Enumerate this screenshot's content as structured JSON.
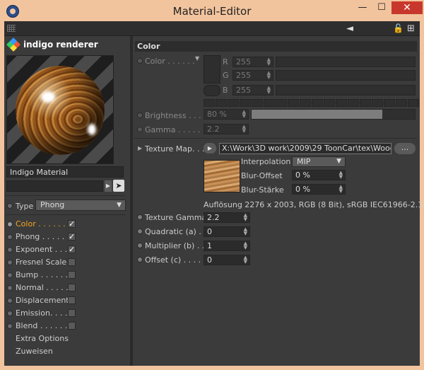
{
  "window": {
    "title": "Material-Editor",
    "min_label": "—",
    "max_label": "☐",
    "close_label": "✕"
  },
  "toolbar": {
    "arrow_glyph": "◄",
    "lock_glyph": "🔓",
    "new_glyph": "⊞"
  },
  "renderer": {
    "name": "indigo renderer"
  },
  "material": {
    "name": "Indigo Material",
    "input_value": ""
  },
  "type": {
    "label": "Type",
    "value": "Phong"
  },
  "channels": [
    {
      "label": "Color . . . . . .",
      "checked": "✓",
      "active": true
    },
    {
      "label": "Phong . . . . . .",
      "checked": "✓",
      "active": false
    },
    {
      "label": "Exponent . . .",
      "checked": "✓",
      "active": false
    },
    {
      "label": "Fresnel Scale",
      "checked": "",
      "active": false
    },
    {
      "label": "Bump . . . . . .",
      "checked": "",
      "active": false
    },
    {
      "label": "Normal . . . . .",
      "checked": "",
      "active": false
    },
    {
      "label": "Displacement",
      "checked": "",
      "active": false
    },
    {
      "label": "Emission. . . .",
      "checked": "",
      "active": false
    },
    {
      "label": "Blend . . . . . .",
      "checked": "",
      "active": false
    }
  ],
  "extra": {
    "extra_options": "Extra Options",
    "zuweisen": "Zuweisen"
  },
  "section": {
    "title": "Color"
  },
  "color": {
    "label": "Color . . . . . .",
    "r_label": "R",
    "g_label": "G",
    "b_label": "B",
    "r": "255",
    "g": "255",
    "b": "255"
  },
  "brightness": {
    "label": "Brightness . . . .",
    "value": "80 %",
    "fill_fraction": 0.8
  },
  "gamma": {
    "label": "Gamma . . . . . . . .",
    "value": "2.2"
  },
  "texture": {
    "label": "Texture Map. . . . .",
    "path": "X:\\Work\\3D work\\2009\\29 ToonCar\\tex\\WoodF",
    "more_label": "...",
    "interpolation_label": "Interpolation",
    "interpolation_value": "MIP",
    "blur_offset_label": "Blur-Offset",
    "blur_offset_value": "0 %",
    "blur_staerke_label": "Blur-Stärke",
    "blur_staerke_value": "0 %",
    "info": "Auflösung 2276 x 2003, RGB (8 Bit), sRGB IEC61966-2.1"
  },
  "params": [
    {
      "label": "Texture Gamma",
      "value": "2.2"
    },
    {
      "label": "Quadratic (a) . .",
      "value": "0"
    },
    {
      "label": "Multiplier (b) . .",
      "value": "1"
    },
    {
      "label": "Offset (c) . . . . .",
      "value": "0"
    }
  ],
  "colors": {
    "accent": "#f5a623",
    "panel": "#3b3b3b",
    "titlebar": "#f2c49e",
    "close": "#c8372c"
  }
}
